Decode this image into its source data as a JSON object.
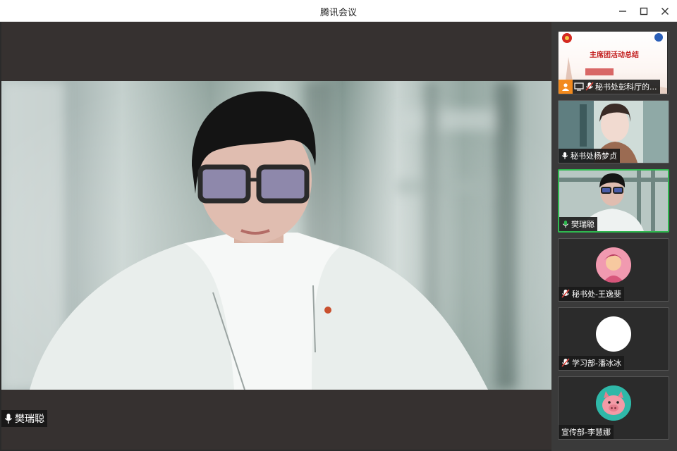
{
  "window": {
    "title": "腾讯会议"
  },
  "main": {
    "speaker_name": "樊瑞聪"
  },
  "participants": [
    {
      "name": "秘书处彭科厅的...",
      "type": "screen-share",
      "slide_title": "主席团活动总结"
    },
    {
      "name": "秘书处杨梦贞",
      "type": "video"
    },
    {
      "name": "樊瑞聪",
      "type": "video",
      "active": true
    },
    {
      "name": "秘书处-王逸斐",
      "type": "avatar",
      "muted": true
    },
    {
      "name": "学习部-潘冰冰",
      "type": "avatar",
      "muted": true
    },
    {
      "name": "宣传部-李慧娜",
      "type": "avatar"
    }
  ],
  "colors": {
    "active_border": "#2fb84f",
    "muted_mic": "#e0473f",
    "share_badge": "#f28a1e"
  },
  "icons": [
    "minimize-icon",
    "maximize-icon",
    "close-icon",
    "mic-icon",
    "mic-muted-icon",
    "person-icon",
    "screen-share-icon"
  ]
}
